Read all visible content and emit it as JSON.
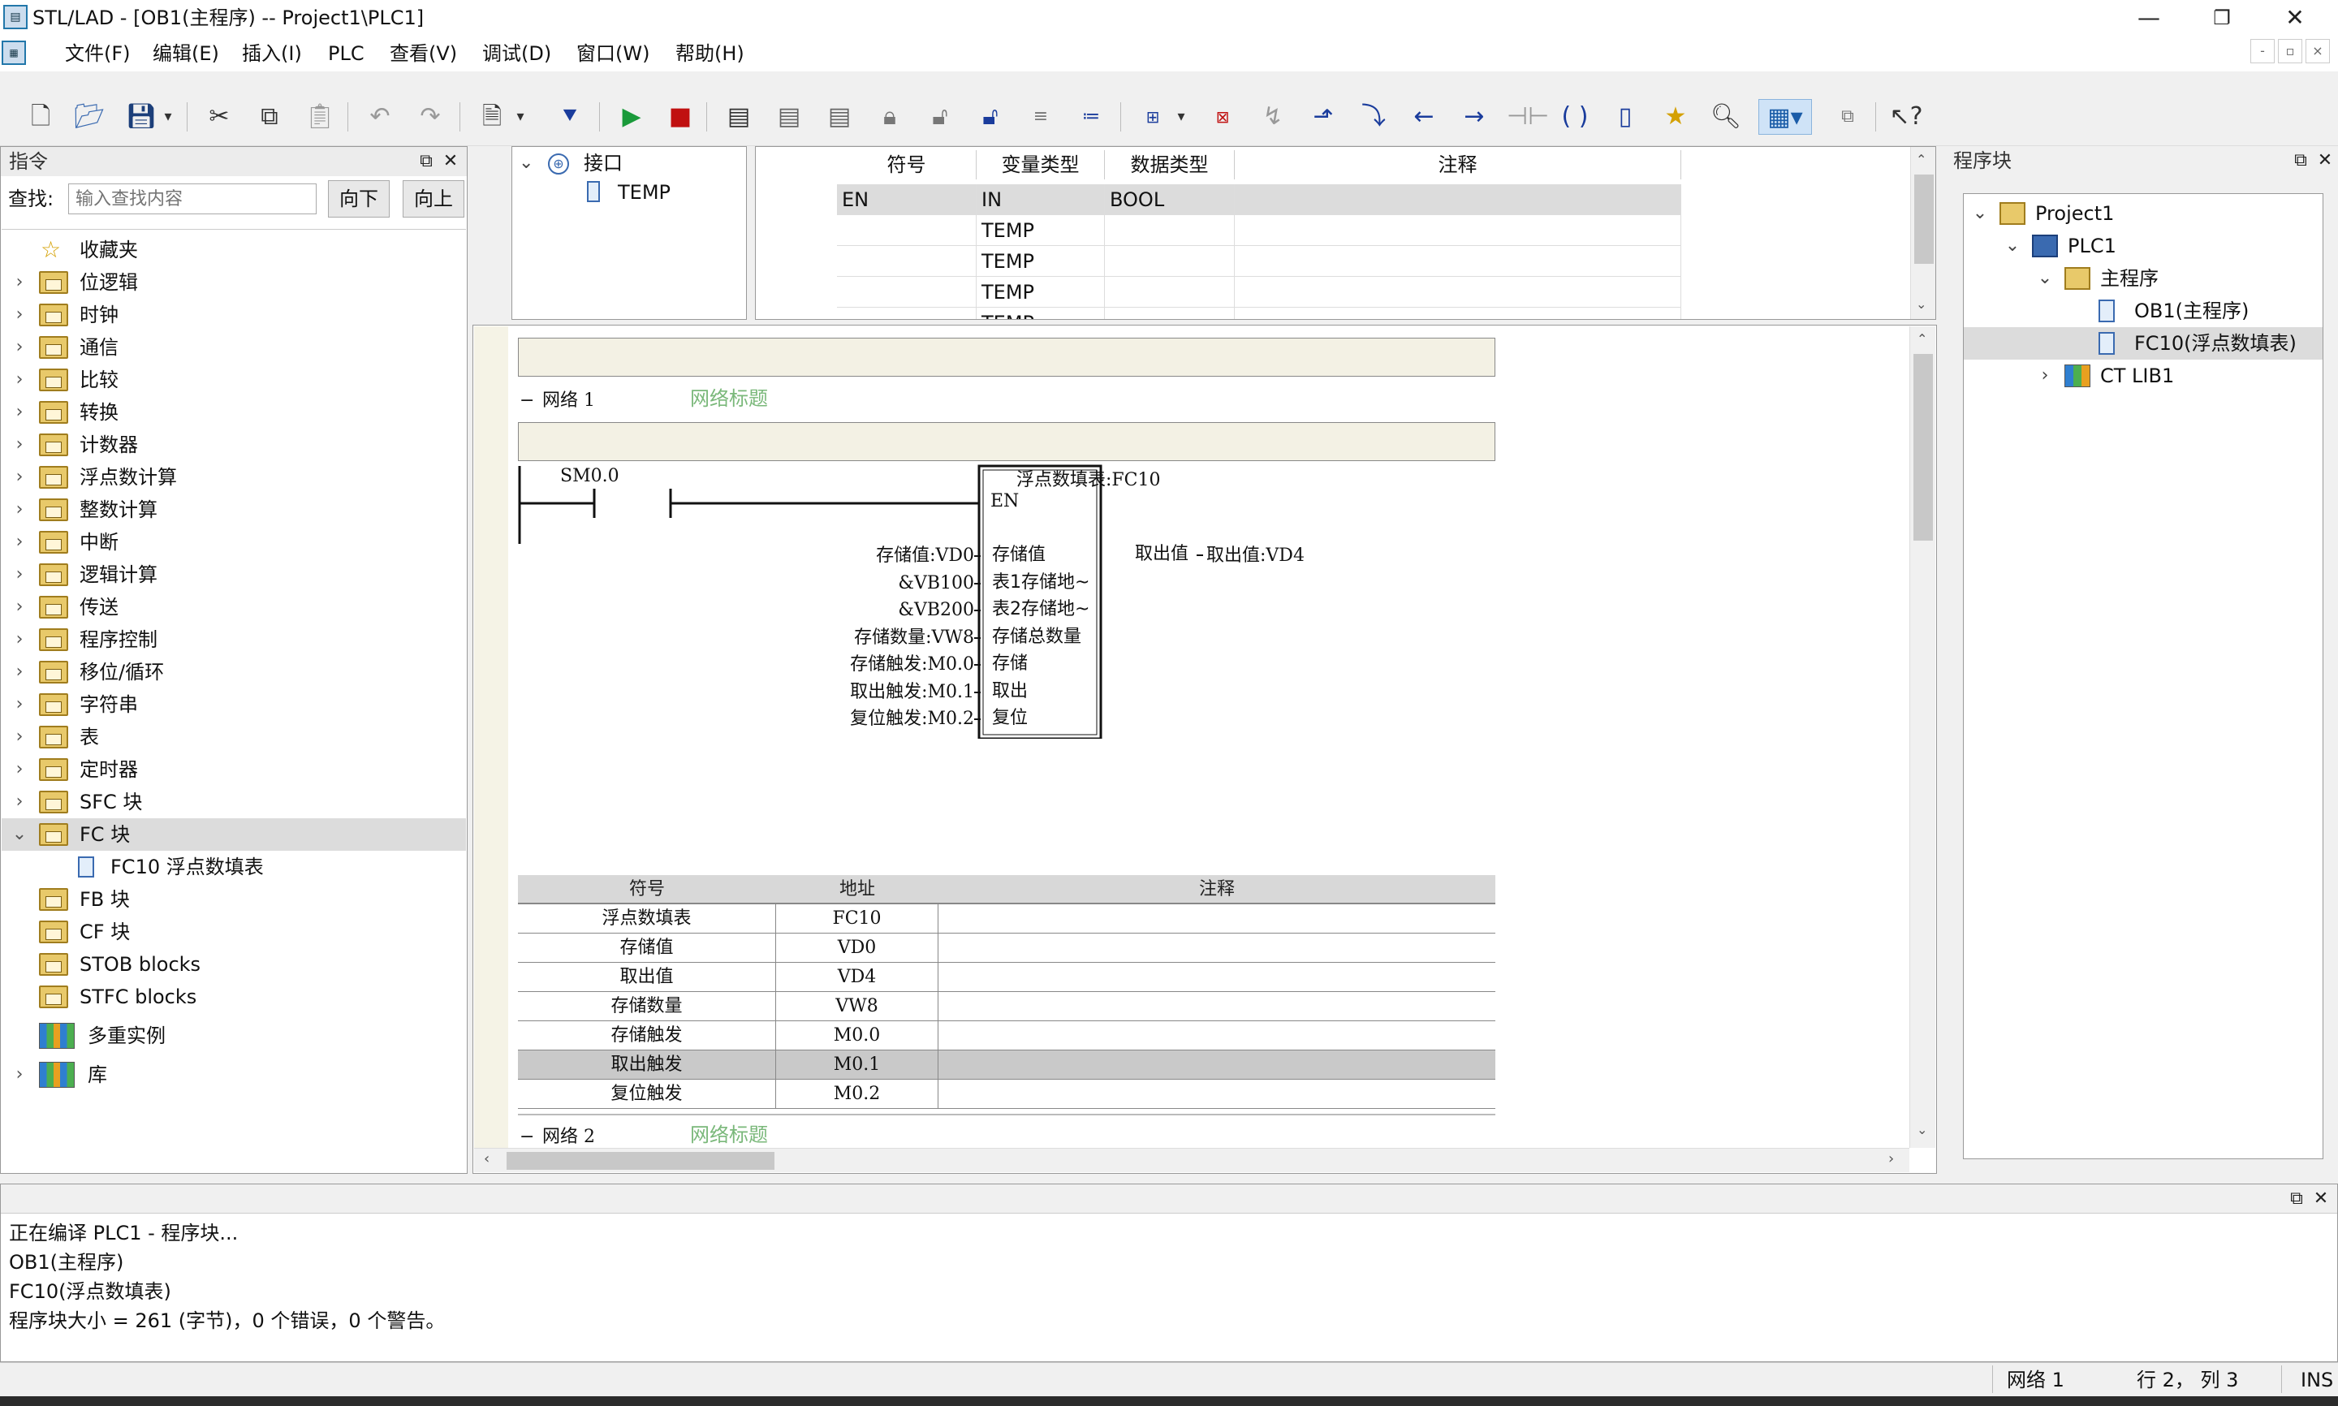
{
  "window": {
    "title": "STL/LAD - [OB1(主程序) -- Project1\\PLC1]",
    "app_icon": "plc-app-icon",
    "minimize": "—",
    "restore": "❐",
    "close": "✕"
  },
  "menu": {
    "items": [
      "文件(F)",
      "编辑(E)",
      "插入(I)",
      "PLC",
      "查看(V)",
      "调试(D)",
      "窗口(W)",
      "帮助(H)"
    ],
    "mdi_min": "-",
    "mdi_restore": "▫",
    "mdi_close": "×"
  },
  "toolbar": {
    "icons": [
      "new-file-icon",
      "open-folder-icon",
      "save-icon",
      "save-dropdown-icon",
      "cut-icon",
      "copy-icon",
      "paste-icon",
      "undo-icon",
      "redo-icon",
      "compile-icon",
      "compile-dropdown-icon",
      "download-icon",
      "run-icon",
      "stop-icon",
      "insert-network-icon",
      "delete-network-icon",
      "network-icon",
      "lock-icon",
      "unlock-icon",
      "protect-icon",
      "indent-icon",
      "comment-icon",
      "monitor-on-icon",
      "monitor-dropdown-icon",
      "monitor-off-icon",
      "negate-icon",
      "branch-up-icon",
      "branch-down-icon",
      "line-left-icon",
      "line-right-icon",
      "contact-icon",
      "coil-icon",
      "box-icon",
      "favorite-icon",
      "zoom-icon",
      "grid-view-icon",
      "grid-dropdown-icon",
      "window-icon",
      "help-context-icon"
    ]
  },
  "left_panel": {
    "title": "指令",
    "search_label": "查找:",
    "search_placeholder": "输入查找内容",
    "btn_down": "向下",
    "btn_up": "向上",
    "items": [
      {
        "label": "收藏夹",
        "icon": "star-icon",
        "expander": ""
      },
      {
        "label": "位逻辑",
        "icon": "folder-bitlogic-icon",
        "expander": "›"
      },
      {
        "label": "时钟",
        "icon": "folder-clock-icon",
        "expander": "›"
      },
      {
        "label": "通信",
        "icon": "folder-comm-icon",
        "expander": "›"
      },
      {
        "label": "比较",
        "icon": "folder-compare-icon",
        "expander": "›"
      },
      {
        "label": "转换",
        "icon": "folder-convert-icon",
        "expander": "›"
      },
      {
        "label": "计数器",
        "icon": "folder-counter-icon",
        "expander": "›"
      },
      {
        "label": "浮点数计算",
        "icon": "folder-float-icon",
        "expander": "›"
      },
      {
        "label": "整数计算",
        "icon": "folder-int-icon",
        "expander": "›"
      },
      {
        "label": "中断",
        "icon": "folder-interrupt-icon",
        "expander": "›"
      },
      {
        "label": "逻辑计算",
        "icon": "folder-logic-icon",
        "expander": "›"
      },
      {
        "label": "传送",
        "icon": "folder-move-icon",
        "expander": "›"
      },
      {
        "label": "程序控制",
        "icon": "folder-progctrl-icon",
        "expander": "›"
      },
      {
        "label": "移位/循环",
        "icon": "folder-shift-icon",
        "expander": "›"
      },
      {
        "label": "字符串",
        "icon": "folder-string-icon",
        "expander": "›"
      },
      {
        "label": "表",
        "icon": "folder-table-icon",
        "expander": "›"
      },
      {
        "label": "定时器",
        "icon": "folder-timer-icon",
        "expander": "›"
      },
      {
        "label": "SFC 块",
        "icon": "folder-sfc-icon",
        "expander": "›"
      },
      {
        "label": "FC 块",
        "icon": "folder-fc-icon",
        "expander": "⌄",
        "selected": true
      },
      {
        "label": "FC10  浮点数填表",
        "icon": "fc-block-icon",
        "expander": "",
        "child": true
      },
      {
        "label": "FB 块",
        "icon": "folder-fb-icon",
        "expander": ""
      },
      {
        "label": "CF 块",
        "icon": "folder-cf-icon",
        "expander": ""
      },
      {
        "label": "STOB blocks",
        "icon": "folder-stob-icon",
        "expander": ""
      },
      {
        "label": "STFC blocks",
        "icon": "folder-stfc-icon",
        "expander": ""
      },
      {
        "label": "多重实例",
        "icon": "books-icon",
        "expander": ""
      },
      {
        "label": "库",
        "icon": "books-icon",
        "expander": "›"
      }
    ]
  },
  "interface_tree": {
    "root": "接口",
    "child": "TEMP",
    "expander": "⌄"
  },
  "interface_table": {
    "headers": [
      "符号",
      "变量类型",
      "数据类型",
      "注释"
    ],
    "rows": [
      [
        "EN",
        "IN",
        "BOOL",
        ""
      ],
      [
        "",
        "TEMP",
        "",
        ""
      ],
      [
        "",
        "TEMP",
        "",
        ""
      ],
      [
        "",
        "TEMP",
        "",
        ""
      ],
      [
        "",
        "TEMP",
        "",
        ""
      ]
    ]
  },
  "editor": {
    "network1": {
      "label": "网络 1",
      "title": "网络标题",
      "collapse": "−"
    },
    "network2": {
      "label": "网络 2",
      "title": "网络标题",
      "collapse": "−"
    },
    "contact": "SM0.0",
    "block": {
      "title": "浮点数填表:FC10",
      "en": "EN",
      "inputs": [
        {
          "pin": "存储值",
          "operand": "存储值:VD0"
        },
        {
          "pin": "表1存储地~",
          "operand": "&VB100"
        },
        {
          "pin": "表2存储地~",
          "operand": "&VB200"
        },
        {
          "pin": "存储总数量",
          "operand": "存储数量:VW8"
        },
        {
          "pin": "存储",
          "operand": "存储触发:M0.0"
        },
        {
          "pin": "取出",
          "operand": "取出触发:M0.1"
        },
        {
          "pin": "复位",
          "operand": "复位触发:M0.2"
        }
      ],
      "output": {
        "pin": "取出值",
        "operand": "取出值:VD4"
      }
    },
    "symbol_table": {
      "headers": [
        "符号",
        "地址",
        "注释"
      ],
      "rows": [
        [
          "浮点数填表",
          "FC10",
          ""
        ],
        [
          "存储值",
          "VD0",
          ""
        ],
        [
          "取出值",
          "VD4",
          ""
        ],
        [
          "存储数量",
          "VW8",
          ""
        ],
        [
          "存储触发",
          "M0.0",
          ""
        ],
        [
          "取出触发",
          "M0.1",
          ""
        ],
        [
          "复位触发",
          "M0.2",
          ""
        ]
      ],
      "selected_row": 5
    }
  },
  "right_panel": {
    "title": "程序块",
    "items": [
      {
        "label": "Project1",
        "icon": "project-icon",
        "expander": "⌄"
      },
      {
        "label": "PLC1",
        "icon": "plc-icon",
        "expander": "⌄"
      },
      {
        "label": "主程序",
        "icon": "folder-main-icon",
        "expander": "⌄"
      },
      {
        "label": "OB1(主程序)",
        "icon": "ob-block-icon",
        "expander": ""
      },
      {
        "label": "FC10(浮点数填表)",
        "icon": "fc-block-icon",
        "expander": "",
        "selected": true
      },
      {
        "label": "CT LIB1",
        "icon": "library-icon",
        "expander": "›"
      }
    ]
  },
  "output": {
    "lines": [
      "正在编译 PLC1 - 程序块...",
      "OB1(主程序)",
      "FC10(浮点数填表)",
      "程序块大小 = 261 (字节)，0 个错误，0 个警告。"
    ]
  },
  "status": {
    "network": "网络 1",
    "position": "行 2，  列 3",
    "mode": "INS"
  },
  "colors": {
    "selection": "#dcdcdc",
    "title_box": "#f3f1e4",
    "network_title": "#7ab87a",
    "folder": "#e8c96a"
  }
}
